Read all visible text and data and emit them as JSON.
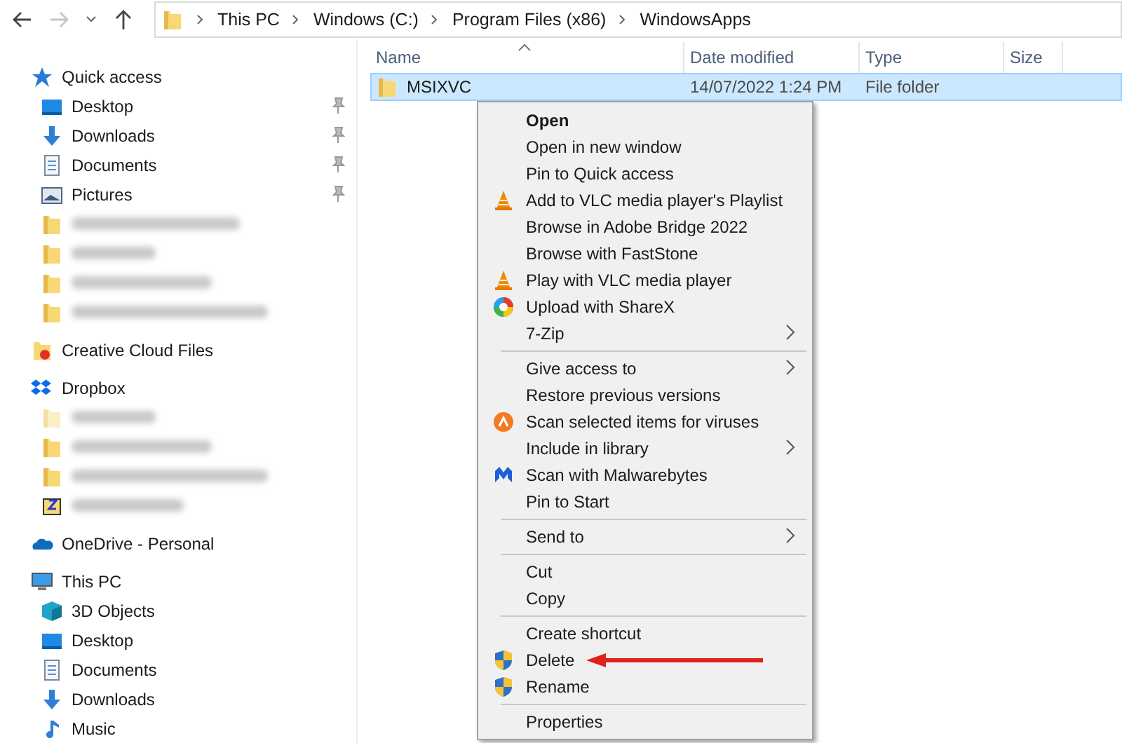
{
  "address_bar": {
    "crumbs": [
      "This PC",
      "Windows (C:)",
      "Program Files (x86)",
      "WindowsApps"
    ]
  },
  "navigation": [
    {
      "label": "Quick access",
      "kind": "star",
      "children": [
        {
          "label": "Desktop",
          "kind": "desktop",
          "pinned": true
        },
        {
          "label": "Downloads",
          "kind": "download",
          "pinned": true
        },
        {
          "label": "Documents",
          "kind": "document",
          "pinned": true
        },
        {
          "label": "Pictures",
          "kind": "pictures",
          "pinned": true
        },
        {
          "kind": "folder",
          "blurred": true
        },
        {
          "kind": "folder",
          "blurred": true
        },
        {
          "kind": "folder",
          "blurred": true
        },
        {
          "kind": "folder",
          "blurred": true
        }
      ]
    },
    {
      "label": "Creative Cloud Files",
      "kind": "cloudfolder"
    },
    {
      "label": "Dropbox",
      "kind": "dropbox",
      "children": [
        {
          "kind": "folderpale",
          "blurred": true
        },
        {
          "kind": "folder",
          "blurred": true
        },
        {
          "kind": "folder",
          "blurred": true
        },
        {
          "kind": "zip",
          "blurred": true
        }
      ]
    },
    {
      "label": "OneDrive - Personal",
      "kind": "onedrive"
    },
    {
      "label": "This PC",
      "kind": "pc",
      "children": [
        {
          "label": "3D Objects",
          "kind": "cube"
        },
        {
          "label": "Desktop",
          "kind": "desktop"
        },
        {
          "label": "Documents",
          "kind": "document"
        },
        {
          "label": "Downloads",
          "kind": "download"
        },
        {
          "label": "Music",
          "kind": "music"
        }
      ]
    }
  ],
  "table": {
    "columns": [
      "Name",
      "Date modified",
      "Type",
      "Size"
    ],
    "rows": [
      {
        "name": "MSIXVC",
        "date_modified": "14/07/2022 1:24 PM",
        "type": "File folder",
        "selected": true
      }
    ]
  },
  "context_menu": [
    {
      "kind": "default",
      "label": "Open"
    },
    {
      "kind": "plain",
      "label": "Open in new window"
    },
    {
      "kind": "plain",
      "label": "Pin to Quick access"
    },
    {
      "kind": "vlc",
      "label": "Add to VLC media player's Playlist"
    },
    {
      "kind": "plain",
      "label": "Browse in Adobe Bridge 2022"
    },
    {
      "kind": "plain",
      "label": "Browse with FastStone"
    },
    {
      "kind": "vlc",
      "label": "Play with VLC media player"
    },
    {
      "kind": "sharex",
      "label": "Upload with ShareX"
    },
    {
      "kind": "plain",
      "label": "7-Zip",
      "submenu": true
    },
    {
      "kind": "separator"
    },
    {
      "kind": "plain",
      "label": "Give access to",
      "submenu": true
    },
    {
      "kind": "plain",
      "label": "Restore previous versions"
    },
    {
      "kind": "avast",
      "label": "Scan selected items for viruses"
    },
    {
      "kind": "plain",
      "label": "Include in library",
      "submenu": true
    },
    {
      "kind": "malwarebytes",
      "label": "Scan with Malwarebytes"
    },
    {
      "kind": "plain",
      "label": "Pin to Start"
    },
    {
      "kind": "separator"
    },
    {
      "kind": "plain",
      "label": "Send to",
      "submenu": true
    },
    {
      "kind": "separator"
    },
    {
      "kind": "plain",
      "label": "Cut"
    },
    {
      "kind": "plain",
      "label": "Copy"
    },
    {
      "kind": "separator"
    },
    {
      "kind": "plain",
      "label": "Create shortcut"
    },
    {
      "kind": "shield",
      "label": "Delete",
      "annotated": true
    },
    {
      "kind": "shield",
      "label": "Rename"
    },
    {
      "kind": "separator"
    },
    {
      "kind": "plain",
      "label": "Properties"
    }
  ]
}
